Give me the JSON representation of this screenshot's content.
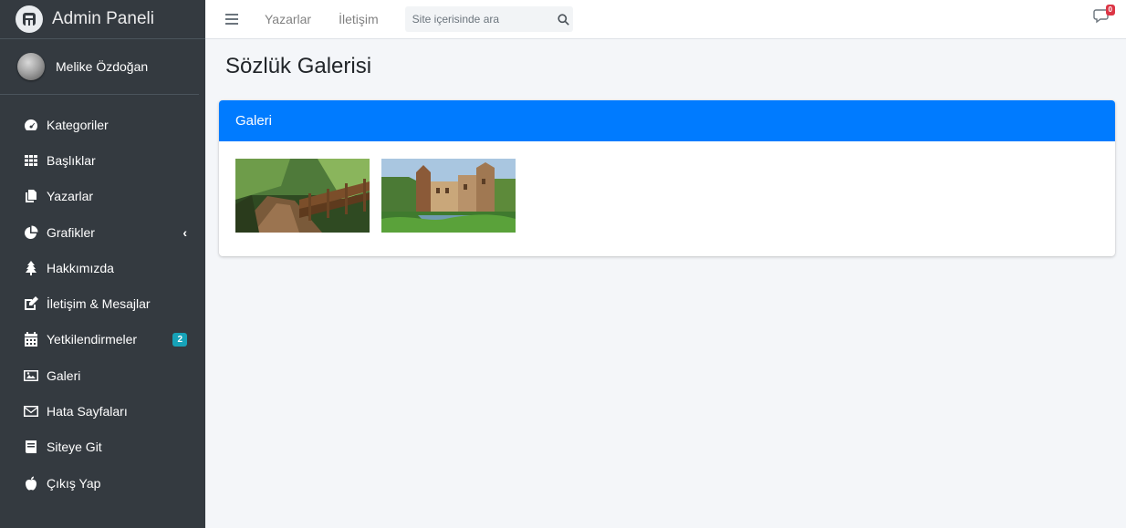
{
  "sidebar": {
    "brand_text": "Admin Paneli",
    "user_name": "Melike Özdoğan",
    "items": [
      {
        "label": "Kategoriler",
        "icon": "tachometer-icon"
      },
      {
        "label": "Başlıklar",
        "icon": "grid-icon"
      },
      {
        "label": "Yazarlar",
        "icon": "copy-icon"
      },
      {
        "label": "Grafikler",
        "icon": "chart-pie-icon"
      },
      {
        "label": "Hakkımızda",
        "icon": "tree-icon"
      },
      {
        "label": "İletişim & Mesajlar",
        "icon": "edit-icon"
      },
      {
        "label": "Yetkilendirmeler",
        "icon": "calendar-icon",
        "badge": "2"
      },
      {
        "label": "Galeri",
        "icon": "image-icon"
      },
      {
        "label": "Hata Sayfaları",
        "icon": "envelope-icon"
      },
      {
        "label": "Siteye Git",
        "icon": "book-icon"
      },
      {
        "label": "Çıkış Yap",
        "icon": "apple-icon"
      }
    ]
  },
  "topbar": {
    "links": [
      "Yazarlar",
      "İletişim"
    ],
    "search_placeholder": "Site içerisinde ara",
    "messages_count": "0"
  },
  "page": {
    "title": "Sözlük Galerisi",
    "card_title": "Galeri"
  },
  "colors": {
    "sidebar_bg": "#343a40",
    "primary": "#007bff",
    "info_badge": "#17a2b8",
    "danger_badge": "#dc3545",
    "content_bg": "#f4f6f9"
  }
}
